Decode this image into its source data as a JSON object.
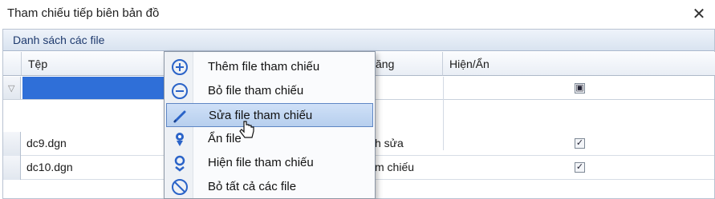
{
  "window": {
    "title": "Tham chiếu tiếp biên bản đồ",
    "close_glyph": "✕"
  },
  "panel": {
    "title": "Danh sách các file"
  },
  "grid": {
    "columns": [
      "Tệp",
      "",
      "ăng",
      "Hiện/Ẩn"
    ],
    "filter_icon": "▽",
    "rows": [
      {
        "file": "dc9.dgn",
        "desc": "h sửa",
        "visible": true
      },
      {
        "file": "dc10.dgn",
        "desc": "m chiếu",
        "visible": true
      }
    ],
    "checked_glyph": "✓"
  },
  "context_menu": {
    "items": [
      {
        "label": "Thêm file tham chiếu",
        "icon": "add-circle-icon"
      },
      {
        "label": "Bỏ file tham chiếu",
        "icon": "remove-circle-icon"
      },
      {
        "label": "Sửa file tham chiếu",
        "icon": "pencil-icon",
        "highlighted": true
      },
      {
        "label": "Ẩn file",
        "icon": "hide-pin-icon"
      },
      {
        "label": "Hiện file tham chiếu",
        "icon": "show-pin-icon"
      },
      {
        "label": "Bỏ tất cả các file",
        "icon": "no-entry-icon"
      }
    ]
  },
  "colors": {
    "accent": "#2f6fd8",
    "menu_highlight": "#b7cfee",
    "icon_blue": "#2a63c8"
  }
}
